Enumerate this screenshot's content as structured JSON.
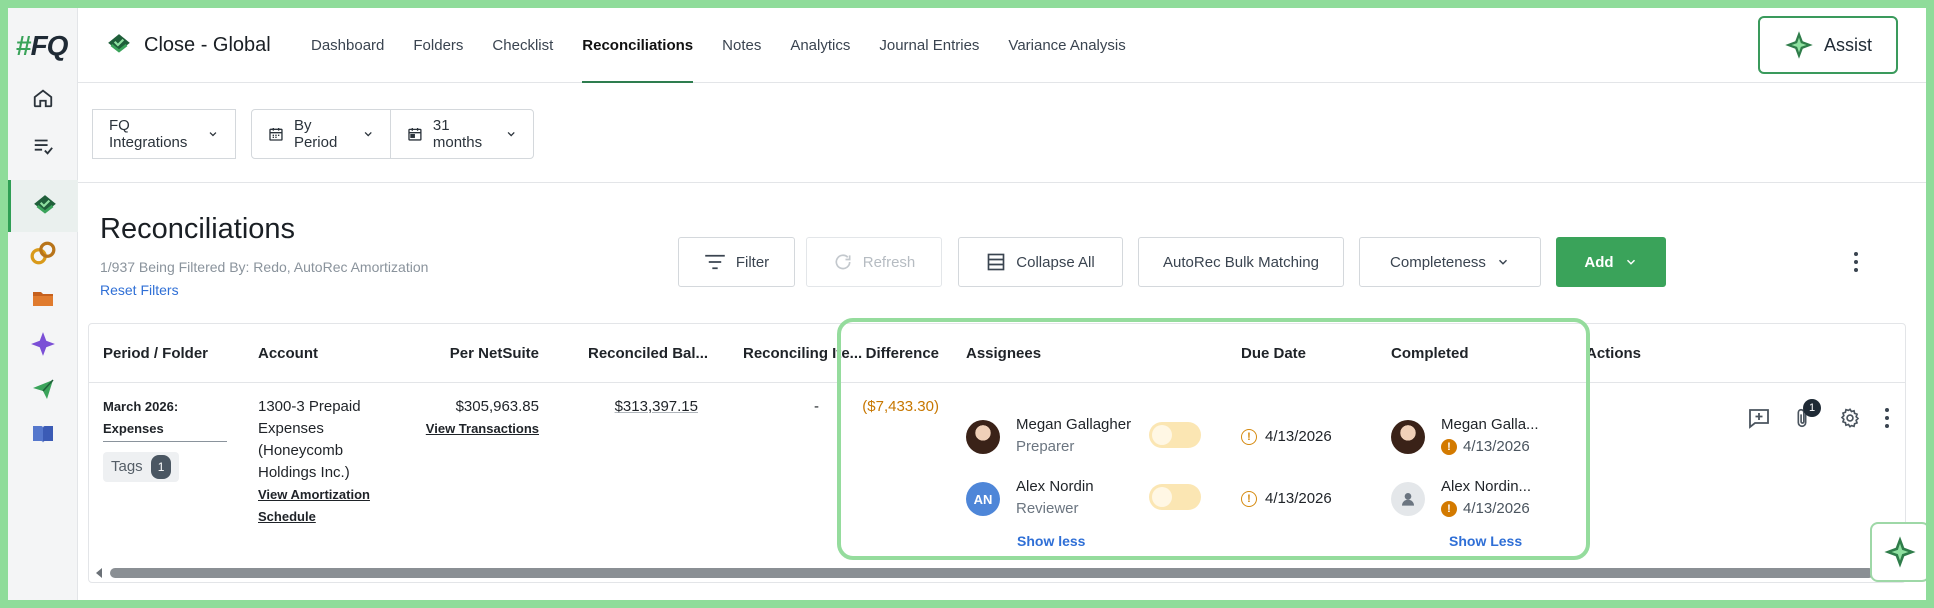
{
  "app": {
    "logo_hash": "#",
    "logo_text": "FQ",
    "workspace_title": "Close - Global",
    "assist_label": "Assist"
  },
  "nav_tabs": [
    {
      "label": "Dashboard"
    },
    {
      "label": "Folders"
    },
    {
      "label": "Checklist"
    },
    {
      "label": "Reconciliations",
      "active": true
    },
    {
      "label": "Notes"
    },
    {
      "label": "Analytics"
    },
    {
      "label": "Journal Entries"
    },
    {
      "label": "Variance Analysis"
    }
  ],
  "rail_icons": [
    "home-icon",
    "list-check-icon",
    "reconciliations-icon",
    "integrations-icon",
    "folder-icon",
    "sparkle-icon",
    "send-icon",
    "book-icon"
  ],
  "filters": {
    "integration": "FQ Integrations",
    "view": "By Period",
    "range": "31 months"
  },
  "page": {
    "title": "Reconciliations",
    "subtitle": "1/937 Being Filtered By: Redo, AutoRec Amortization",
    "reset_filters": "Reset Filters"
  },
  "toolbar": {
    "filter": "Filter",
    "refresh": "Refresh",
    "collapse_all": "Collapse All",
    "autorec_bulk": "AutoRec Bulk Matching",
    "completeness": "Completeness",
    "add": "Add"
  },
  "table": {
    "headers": {
      "period": "Period / Folder",
      "account": "Account",
      "per_netsuite": "Per NetSuite",
      "reconciled_bal": "Reconciled Bal...",
      "reconciling_items": "Reconciling Ite...",
      "difference": "Difference",
      "assignees": "Assignees",
      "due_date": "Due Date",
      "completed": "Completed",
      "actions": "Actions"
    },
    "row": {
      "period_line1": "March 2026:",
      "period_line2": "Expenses",
      "tags_label": "Tags",
      "tags_count": "1",
      "account_line1": "1300-3 Prepaid",
      "account_line2": "Expenses",
      "account_line3": "(Honeycomb",
      "account_line4": "Holdings Inc.)",
      "view_amortization_line1": "View Amortization",
      "view_amortization_line2": "Schedule",
      "per_netsuite": "$305,963.85",
      "view_transactions": "View Transactions",
      "reconciled_bal": "$313,397.15",
      "reconciling_items": "-",
      "difference": "($7,433.30)",
      "attachments_count": "1",
      "assignees": [
        {
          "name": "Megan Gallagher",
          "role": "Preparer",
          "due_date": "4/13/2026",
          "completed_name": "Megan Galla...",
          "completed_date": "4/13/2026"
        },
        {
          "name": "Alex Nordin",
          "initials": "AN",
          "role": "Reviewer",
          "due_date": "4/13/2026",
          "completed_name": "Alex Nordin...",
          "completed_date": "4/13/2026"
        }
      ],
      "show_less_assignees": "Show less",
      "show_less_completed": "Show Less"
    }
  },
  "colors": {
    "brand_green": "#3aa35a",
    "link_blue": "#2f6fd6",
    "negative_amber": "#c77700",
    "highlight_green": "#95dc9d"
  }
}
